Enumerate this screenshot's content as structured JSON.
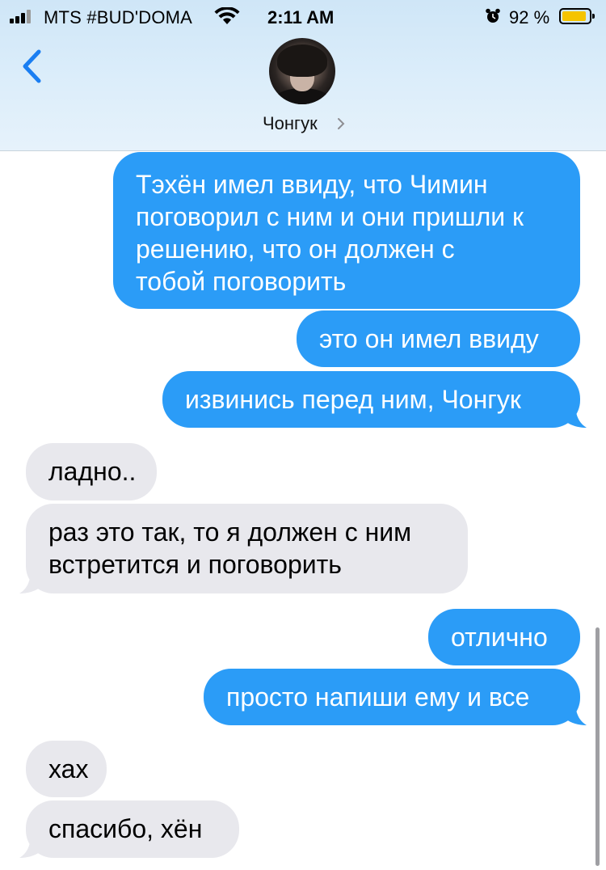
{
  "status_bar": {
    "carrier": "MTS #BUD'DOMA",
    "time": "2:11 AM",
    "battery_percent": "92 %",
    "battery_level": 0.92,
    "icons": [
      "signal-icon",
      "wifi-icon",
      "alarm-icon",
      "battery-icon"
    ]
  },
  "header": {
    "back_icon": "chevron-left-icon",
    "contact_name": "Чонгук",
    "contact_chevron_icon": "chevron-right-icon"
  },
  "messages": [
    {
      "direction": "outgoing",
      "lines": [
        "Тэхён имел ввиду, что Чимин",
        "поговорил с ним и они пришли к",
        "решению, что он должен с",
        "тобой поговорить"
      ]
    },
    {
      "direction": "outgoing",
      "lines": [
        "это он имел ввиду"
      ]
    },
    {
      "direction": "outgoing",
      "lines": [
        "извинись перед ним, Чонгук"
      ]
    },
    {
      "direction": "incoming",
      "lines": [
        "ладно.."
      ]
    },
    {
      "direction": "incoming",
      "lines": [
        "раз это так, то я должен с ним",
        "встретится и поговорить"
      ]
    },
    {
      "direction": "outgoing",
      "lines": [
        "отлично"
      ]
    },
    {
      "direction": "outgoing",
      "lines": [
        "просто напиши ему и все"
      ]
    },
    {
      "direction": "incoming",
      "lines": [
        "хах"
      ]
    },
    {
      "direction": "incoming",
      "lines": [
        "спасибо, хён"
      ]
    }
  ],
  "colors": {
    "outgoing_bubble": "#2b9cf7",
    "incoming_bubble": "#e8e8ed",
    "accent": "#1a7ef2",
    "battery": "#f5c400"
  }
}
